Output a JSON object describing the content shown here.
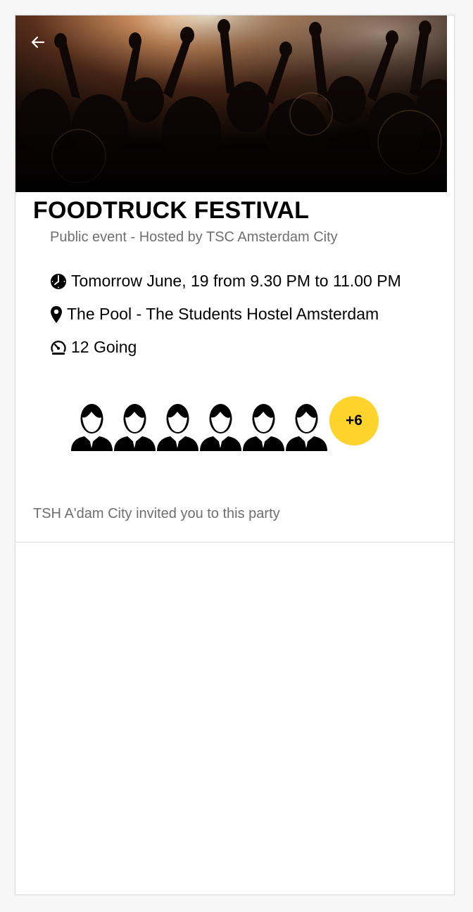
{
  "event": {
    "title": "FOODTRUCK FESTIVAL",
    "subtitle": "Public event - Hosted by TSC Amsterdam City",
    "time": "Tomorrow June, 19 from 9.30 PM to 11.00 PM",
    "location": "The Pool - The Students Hostel Amsterdam",
    "going": "12 Going"
  },
  "attendees": {
    "avatars": [
      "person-icon",
      "person-icon",
      "person-icon",
      "person-icon",
      "person-icon",
      "person-icon"
    ],
    "more_label": "+6"
  },
  "invite_text": "TSH A'dam City invited you to this party",
  "icons": {
    "back": "arrow-left-icon",
    "time": "clock-icon",
    "location": "map-pin-icon",
    "going": "gauge-icon"
  },
  "colors": {
    "accent": "#fdd32c",
    "secondary_text": "#6f6f6f"
  }
}
